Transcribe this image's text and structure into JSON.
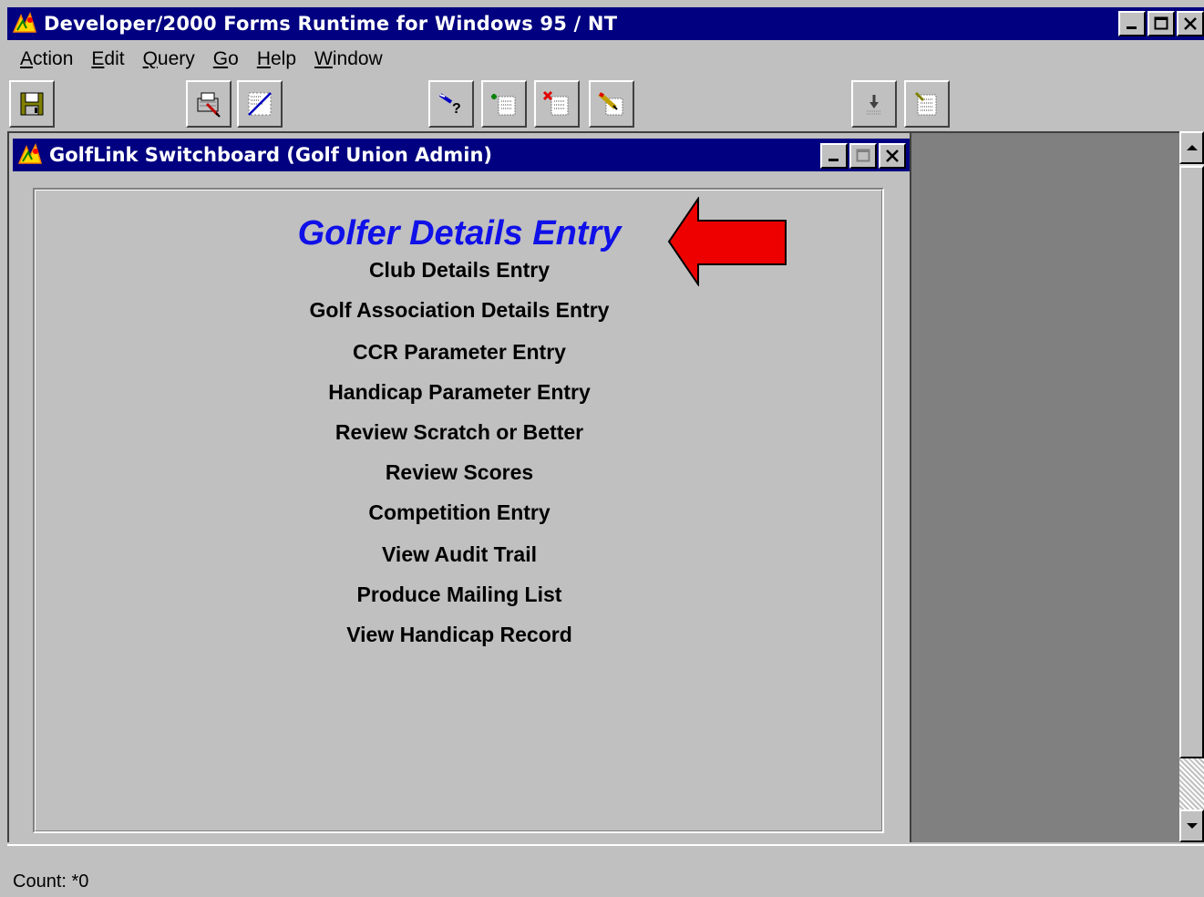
{
  "window": {
    "title": "Developer/2000 Forms Runtime for Windows 95 / NT",
    "app_icon": "oracle-forms-icon"
  },
  "menu": {
    "items": [
      {
        "accel": "A",
        "rest": "ction"
      },
      {
        "accel": "E",
        "rest": "dit"
      },
      {
        "accel": "Q",
        "rest": "uery"
      },
      {
        "accel": "G",
        "rest": "o"
      },
      {
        "accel": "H",
        "rest": "elp"
      },
      {
        "accel": "W",
        "rest": "indow"
      }
    ]
  },
  "toolbar": {
    "buttons": [
      "save-icon",
      "print-icon",
      "clear-icon",
      "query-help-icon",
      "insert-record-icon",
      "delete-record-icon",
      "edit-icon",
      "next-record-icon",
      "list-icon"
    ]
  },
  "child_window": {
    "title": "GolfLink Switchboard (Golf Union Admin)",
    "heading": "Golfer Details Entry",
    "items": [
      "Club Details Entry",
      "Golf Association Details Entry",
      "CCR Parameter Entry",
      "Handicap Parameter Entry",
      "Review Scratch or Better",
      "Review Scores",
      "Competition Entry",
      "View Audit Trail",
      "Produce Mailing List",
      "View Handicap Record"
    ]
  },
  "annotation": {
    "arrow_color": "#ee0000",
    "arrow_icon": "red-left-arrow"
  },
  "status": {
    "text": "Count: *0"
  },
  "colors": {
    "title_bar": "#000080",
    "heading": "#1010e8",
    "window_face": "#c0c0c0",
    "mdi_background": "#808080"
  }
}
